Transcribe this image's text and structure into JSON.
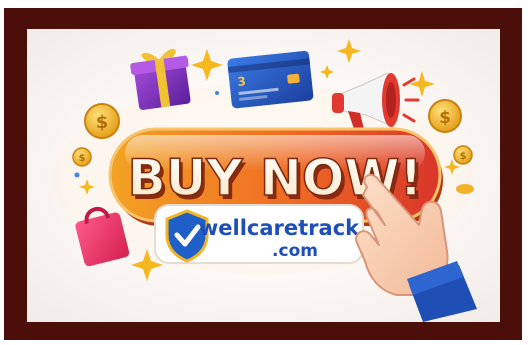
{
  "headline": "BUY NOW!",
  "badge": {
    "brand_name": "wellcaretrack",
    "brand_tld": ".com"
  },
  "credit_card": {
    "number_digit": "3"
  },
  "colors": {
    "frame": "#4b0e08",
    "button_orange": "#f08a1f",
    "button_red": "#e0362a",
    "shield_blue": "#1f5fc8",
    "brand_blue": "#1e4fb8",
    "gold": "#f4b51e"
  },
  "icons": [
    "gift-icon",
    "credit-card-icon",
    "megaphone-icon",
    "coin-icon",
    "shopping-bag-icon",
    "sparkle-icon",
    "pointing-hand-icon",
    "shield-check-icon"
  ]
}
